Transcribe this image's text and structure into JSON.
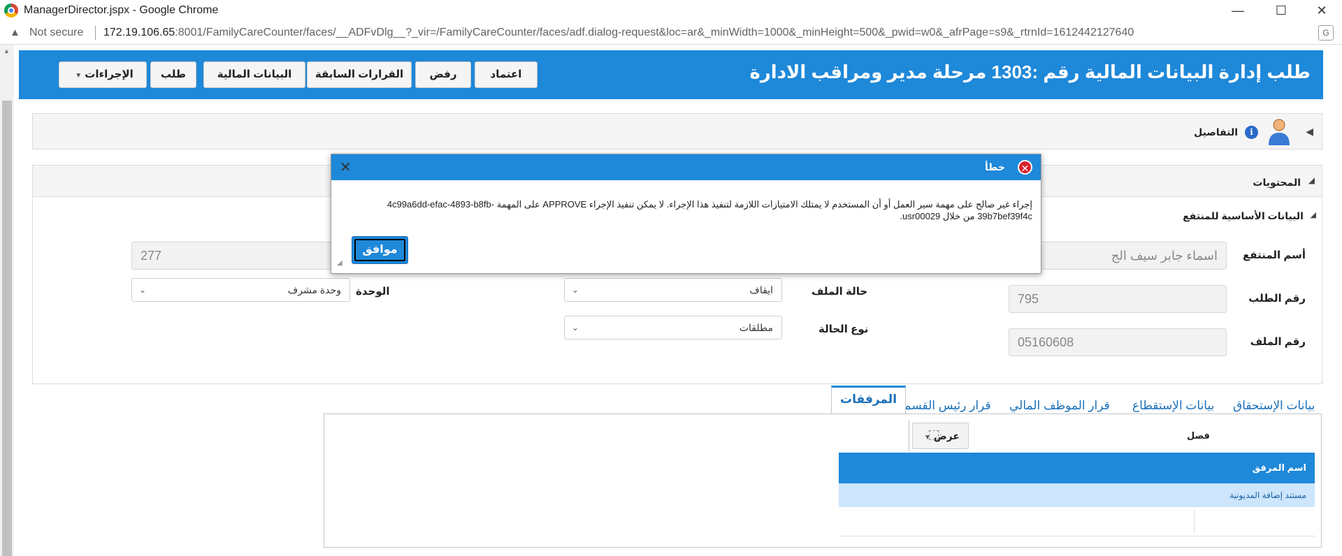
{
  "window": {
    "title": "ManagerDirector.jspx - Google Chrome",
    "not_secure": "Not secure",
    "url_host": "172.19.106.65",
    "url_rest": ":8001/FamilyCareCounter/faces/__ADFvDlg__?_vir=/FamilyCareCounter/faces/adf.dialog-request&loc=ar&_minWidth=1000&_minHeight=500&_pwid=w0&_afrPage=s9&_rtrnId=1612442127640"
  },
  "header": {
    "title": "طلب إدارة البيانات المالية رقم :1303 مرحلة مدير ومراقب الادارة",
    "buttons": {
      "actions": "الإجراءات",
      "request": "طلب",
      "finance": "البيانات المالية",
      "previous": "القرارات السابقة",
      "reject": "رفض",
      "approve": "اعتماد"
    }
  },
  "details": {
    "label": "التفاصيل"
  },
  "contents": {
    "label": "المحتويات",
    "section": "البيانات الأساسية للمنتفع"
  },
  "form": {
    "beneficiary_name_label": "أسم المنتفع",
    "beneficiary_name_value": "اسماء جابر سيف الج",
    "top_left_value": "277",
    "request_no_label": "رقم الطلب",
    "request_no_value": "795",
    "file_no_label": "رقم الملف",
    "file_no_value": "05160608",
    "file_status_label": "حالة الملف",
    "file_status_value": "ايقاف",
    "case_type_label": "نوع الحالة",
    "case_type_value": "مطلقات",
    "unit_label": "الوحدة",
    "unit_value": "وحدة مشرف"
  },
  "tabs": [
    "بيانات الإستحقاق",
    "بيانات الإستقطاع",
    "قرار الموظف المالي",
    "قرار رئيس القسم",
    "المرفقات"
  ],
  "attachments": {
    "view_label": "عرض",
    "detach_label": "فصل",
    "column_header": "اسم المرفق",
    "row_1": "مستند إضافة المديونية"
  },
  "dialog": {
    "title": "خطأ",
    "message": "إجراء غير صالح على مهمة سير العمل أو أن المستخدم لا يمتلك الامتيازات اللازمة لتنفيذ هذا الإجراء. لا يمكن تنفيذ الإجراء APPROVE على المهمة 4c99a6dd-efac-4893-b8fb-39b7bef39f4c من خلال usr00029.",
    "ok": "موافق"
  }
}
